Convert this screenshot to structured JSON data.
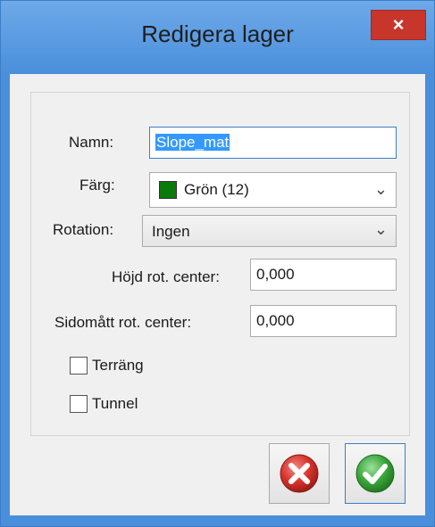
{
  "window": {
    "title": "Redigera lager",
    "close_glyph": "×"
  },
  "form": {
    "name_label": "Namn:",
    "name_value": "Slope_mat",
    "color_label": "Färg:",
    "color_value": "Grön (12)",
    "color_swatch": "#0a7a0a",
    "rotation_label": "Rotation:",
    "rotation_value": "Ingen",
    "height_label": "Höjd rot. center:",
    "height_value": "0,000",
    "side_label": "Sidomått rot. center:",
    "side_value": "0,000",
    "terrain_label": "Terräng",
    "terrain_checked": false,
    "tunnel_label": "Tunnel",
    "tunnel_checked": false
  },
  "buttons": {
    "cancel_icon": "cancel-icon",
    "ok_icon": "checkmark-icon"
  },
  "colors": {
    "accent": "#3c7fc7",
    "cancel": "#d7322a",
    "ok": "#3aa53a"
  }
}
